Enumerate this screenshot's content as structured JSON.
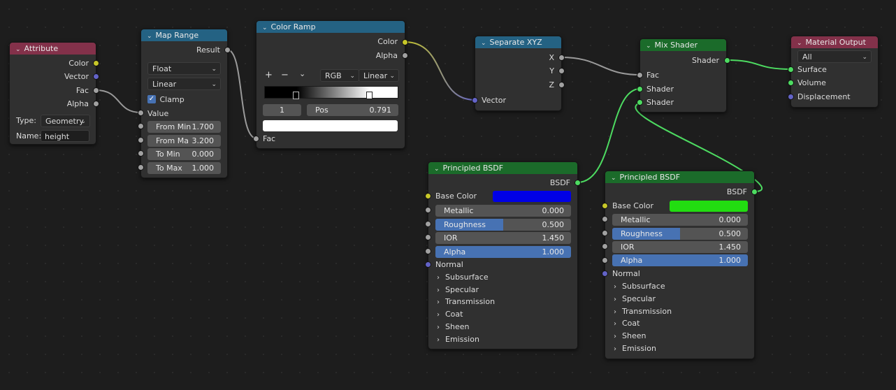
{
  "colors": {
    "canvas_bg": "#1d1d1d",
    "node_bg": "#303030",
    "header_input": "#83314a",
    "header_converter": "#246283",
    "header_shader": "#1b6b2a",
    "socket_color": "#c7c729",
    "socket_vector": "#6363c7",
    "socket_float": "#a1a1a1",
    "socket_shader": "#4ddb61",
    "field_bg": "#545454",
    "slider_fill": "#4772b3",
    "base_color_blue": "#0000e6",
    "base_color_green": "#22dd11"
  },
  "attribute_node": {
    "title": "Attribute",
    "outputs": [
      "Color",
      "Vector",
      "Fac",
      "Alpha"
    ],
    "type_label": "Type:",
    "type_value": "Geometry",
    "name_label": "Name:",
    "name_value": "height"
  },
  "map_range_node": {
    "title": "Map Range",
    "output": "Result",
    "data_type": "Float",
    "interpolation": "Linear",
    "clamp_label": "Clamp",
    "clamp_checked": true,
    "value_label": "Value",
    "fields": [
      {
        "label": "From Min",
        "value": "1.700"
      },
      {
        "label": "From Ma",
        "value": "3.200"
      },
      {
        "label": "To Min",
        "value": "0.000"
      },
      {
        "label": "To Max",
        "value": "1.000"
      }
    ]
  },
  "color_ramp_node": {
    "title": "Color Ramp",
    "outputs": [
      "Color",
      "Alpha"
    ],
    "add_label": "+",
    "remove_label": "−",
    "menu_label": "⌄",
    "color_mode": "RGB",
    "interpolation": "Linear",
    "stop_index": "1",
    "pos_label": "Pos",
    "pos_value": "0.791",
    "input": "Fac"
  },
  "separate_xyz_node": {
    "title": "Separate XYZ",
    "outputs": [
      "X",
      "Y",
      "Z"
    ],
    "input": "Vector"
  },
  "mix_shader_node": {
    "title": "Mix Shader",
    "output": "Shader",
    "inputs": [
      "Fac",
      "Shader",
      "Shader"
    ]
  },
  "material_output_node": {
    "title": "Material Output",
    "target": "All",
    "inputs": [
      "Surface",
      "Volume",
      "Displacement"
    ]
  },
  "bsdf_blue": {
    "title": "Principled BSDF",
    "output": "BSDF",
    "base_color_label": "Base Color",
    "fields": [
      {
        "label": "Metallic",
        "value": "0.000",
        "fill": 0.0
      },
      {
        "label": "Roughness",
        "value": "0.500",
        "fill": 0.5
      },
      {
        "label": "IOR",
        "value": "1.450",
        "fill": 0.0
      },
      {
        "label": "Alpha",
        "value": "1.000",
        "fill": 1.0
      }
    ],
    "normal_label": "Normal",
    "panels": [
      "Subsurface",
      "Specular",
      "Transmission",
      "Coat",
      "Sheen",
      "Emission"
    ]
  },
  "bsdf_green": {
    "title": "Principled BSDF",
    "output": "BSDF",
    "base_color_label": "Base Color",
    "fields": [
      {
        "label": "Metallic",
        "value": "0.000",
        "fill": 0.0
      },
      {
        "label": "Roughness",
        "value": "0.500",
        "fill": 0.5
      },
      {
        "label": "IOR",
        "value": "1.450",
        "fill": 0.0
      },
      {
        "label": "Alpha",
        "value": "1.000",
        "fill": 1.0
      }
    ],
    "normal_label": "Normal",
    "panels": [
      "Subsurface",
      "Specular",
      "Transmission",
      "Coat",
      "Sheen",
      "Emission"
    ]
  }
}
